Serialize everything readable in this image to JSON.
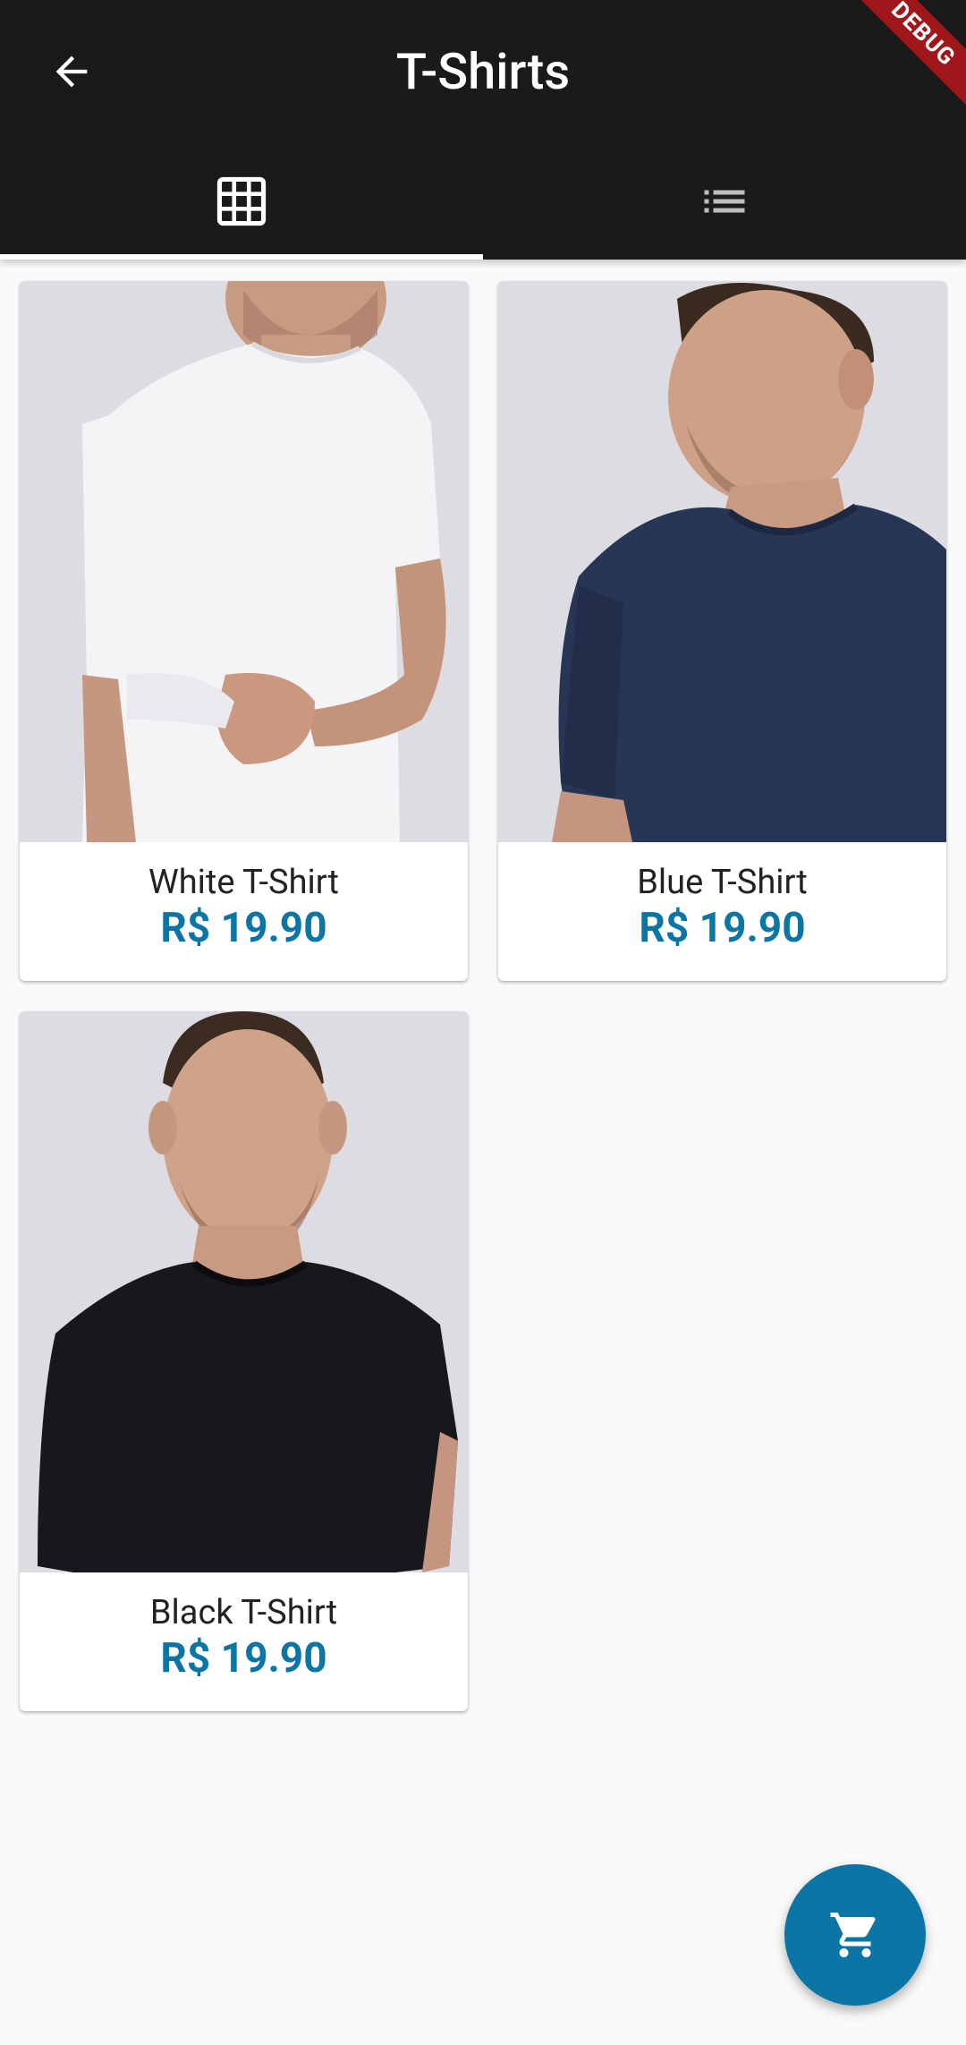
{
  "appbar": {
    "title": "T-Shirts",
    "back_icon": "arrow-back-icon",
    "debug_banner": "DEBUG"
  },
  "tabs": [
    {
      "icon": "grid-view-icon",
      "selected": true
    },
    {
      "icon": "list-view-icon",
      "selected": false
    }
  ],
  "products": [
    {
      "name": "White T-Shirt",
      "price": "R$ 19.90",
      "shirt_color": "#f4f4f6"
    },
    {
      "name": "Blue T-Shirt",
      "price": "R$ 19.90",
      "shirt_color": "#283656"
    },
    {
      "name": "Black T-Shirt",
      "price": "R$ 19.90",
      "shirt_color": "#17181b"
    }
  ],
  "fab": {
    "icon": "shopping-cart-icon"
  },
  "colors": {
    "appbar_bg": "#1a1a1a",
    "accent": "#0b76a6",
    "page_bg": "#fafafa"
  }
}
